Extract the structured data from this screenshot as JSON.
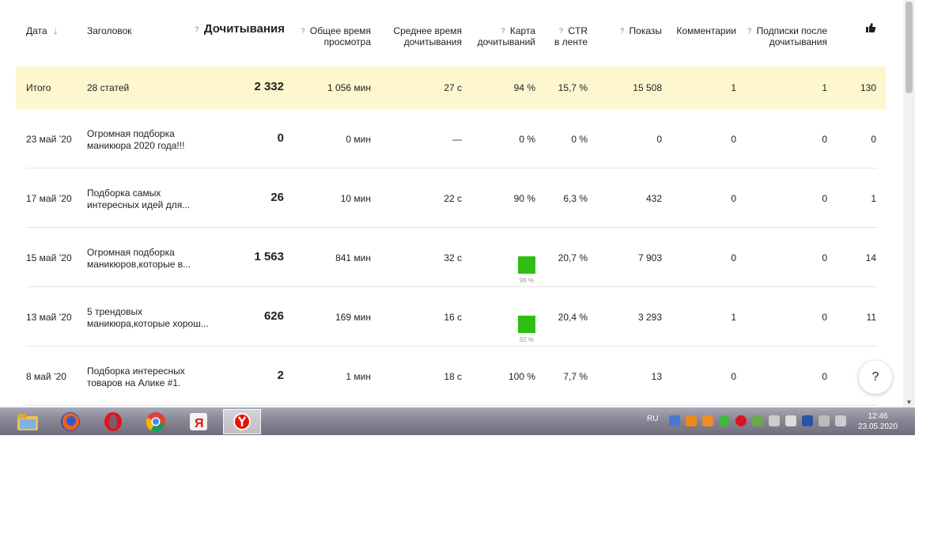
{
  "header": {
    "date": "Дата",
    "title": "Заголовок",
    "reads": "Дочитывания",
    "total_time_l1": "Общее время",
    "total_time_l2": "просмотра",
    "avg_time_l1": "Среднее время",
    "avg_time_l2": "дочитывания",
    "map_l1": "Карта",
    "map_l2": "дочитываний",
    "ctr_l1": "CTR",
    "ctr_l2": "в ленте",
    "views": "Показы",
    "comments": "Комментарии",
    "subs_l1": "Подписки после",
    "subs_l2": "дочитывания",
    "help_mark": "?",
    "sort_arrow": "↓"
  },
  "total": {
    "label": "Итого",
    "articles": "28 статей",
    "reads": "2 332",
    "total_time": "1 056 мин",
    "avg_time": "27 с",
    "map": "94 %",
    "ctr": "15,7 %",
    "views": "15 508",
    "comments": "1",
    "subs": "1",
    "likes": "130"
  },
  "rows": [
    {
      "date": "23 май ’20",
      "title_l1": "Огромная подборка",
      "title_l2": "маникюра 2020 года!!!",
      "reads": "0",
      "total_time": "0 мин",
      "avg_time": "—",
      "map": "0 %",
      "map_bar": false,
      "ctr": "0 %",
      "views": "0",
      "comments": "0",
      "subs": "0",
      "likes": "0"
    },
    {
      "date": "17 май ’20",
      "title_l1": "Подборка самых",
      "title_l2": "интересных идей для...",
      "reads": "26",
      "total_time": "10 мин",
      "avg_time": "22 с",
      "map": "90 %",
      "map_bar": false,
      "ctr": "6,3 %",
      "views": "432",
      "comments": "0",
      "subs": "0",
      "likes": "1"
    },
    {
      "date": "15 май ’20",
      "title_l1": "Огромная подборка",
      "title_l2": "маникюров,которые в...",
      "reads": "1 563",
      "total_time": "841 мин",
      "avg_time": "32 с",
      "map": "96 %",
      "map_bar": true,
      "ctr": "20,7 %",
      "views": "7 903",
      "comments": "0",
      "subs": "0",
      "likes": "14"
    },
    {
      "date": "13 май ’20",
      "title_l1": "5 трендовых",
      "title_l2": "маникюра,которые хорош...",
      "reads": "626",
      "total_time": "169 мин",
      "avg_time": "16 с",
      "map": "92 %",
      "map_bar": true,
      "ctr": "20,4 %",
      "views": "3 293",
      "comments": "1",
      "subs": "0",
      "likes": "11"
    },
    {
      "date": "8 май ’20",
      "title_l1": "Подборка интересных",
      "title_l2": "товаров на Алике #1.",
      "reads": "2",
      "total_time": "1 мин",
      "avg_time": "18 с",
      "map": "100 %",
      "map_bar": false,
      "ctr": "7,7 %",
      "views": "13",
      "comments": "0",
      "subs": "0",
      "likes": ""
    }
  ],
  "help_button": "?",
  "taskbar": {
    "lang": "RU",
    "time": "12:46",
    "date": "23.05.2020",
    "icons": [
      "explorer-icon",
      "firefox-icon",
      "opera-icon",
      "chrome-icon",
      "yandex-icon",
      "yandex-browser-icon"
    ]
  },
  "colors": {
    "total_bg": "#fdf6cf",
    "map_green": "#2fbf14"
  }
}
